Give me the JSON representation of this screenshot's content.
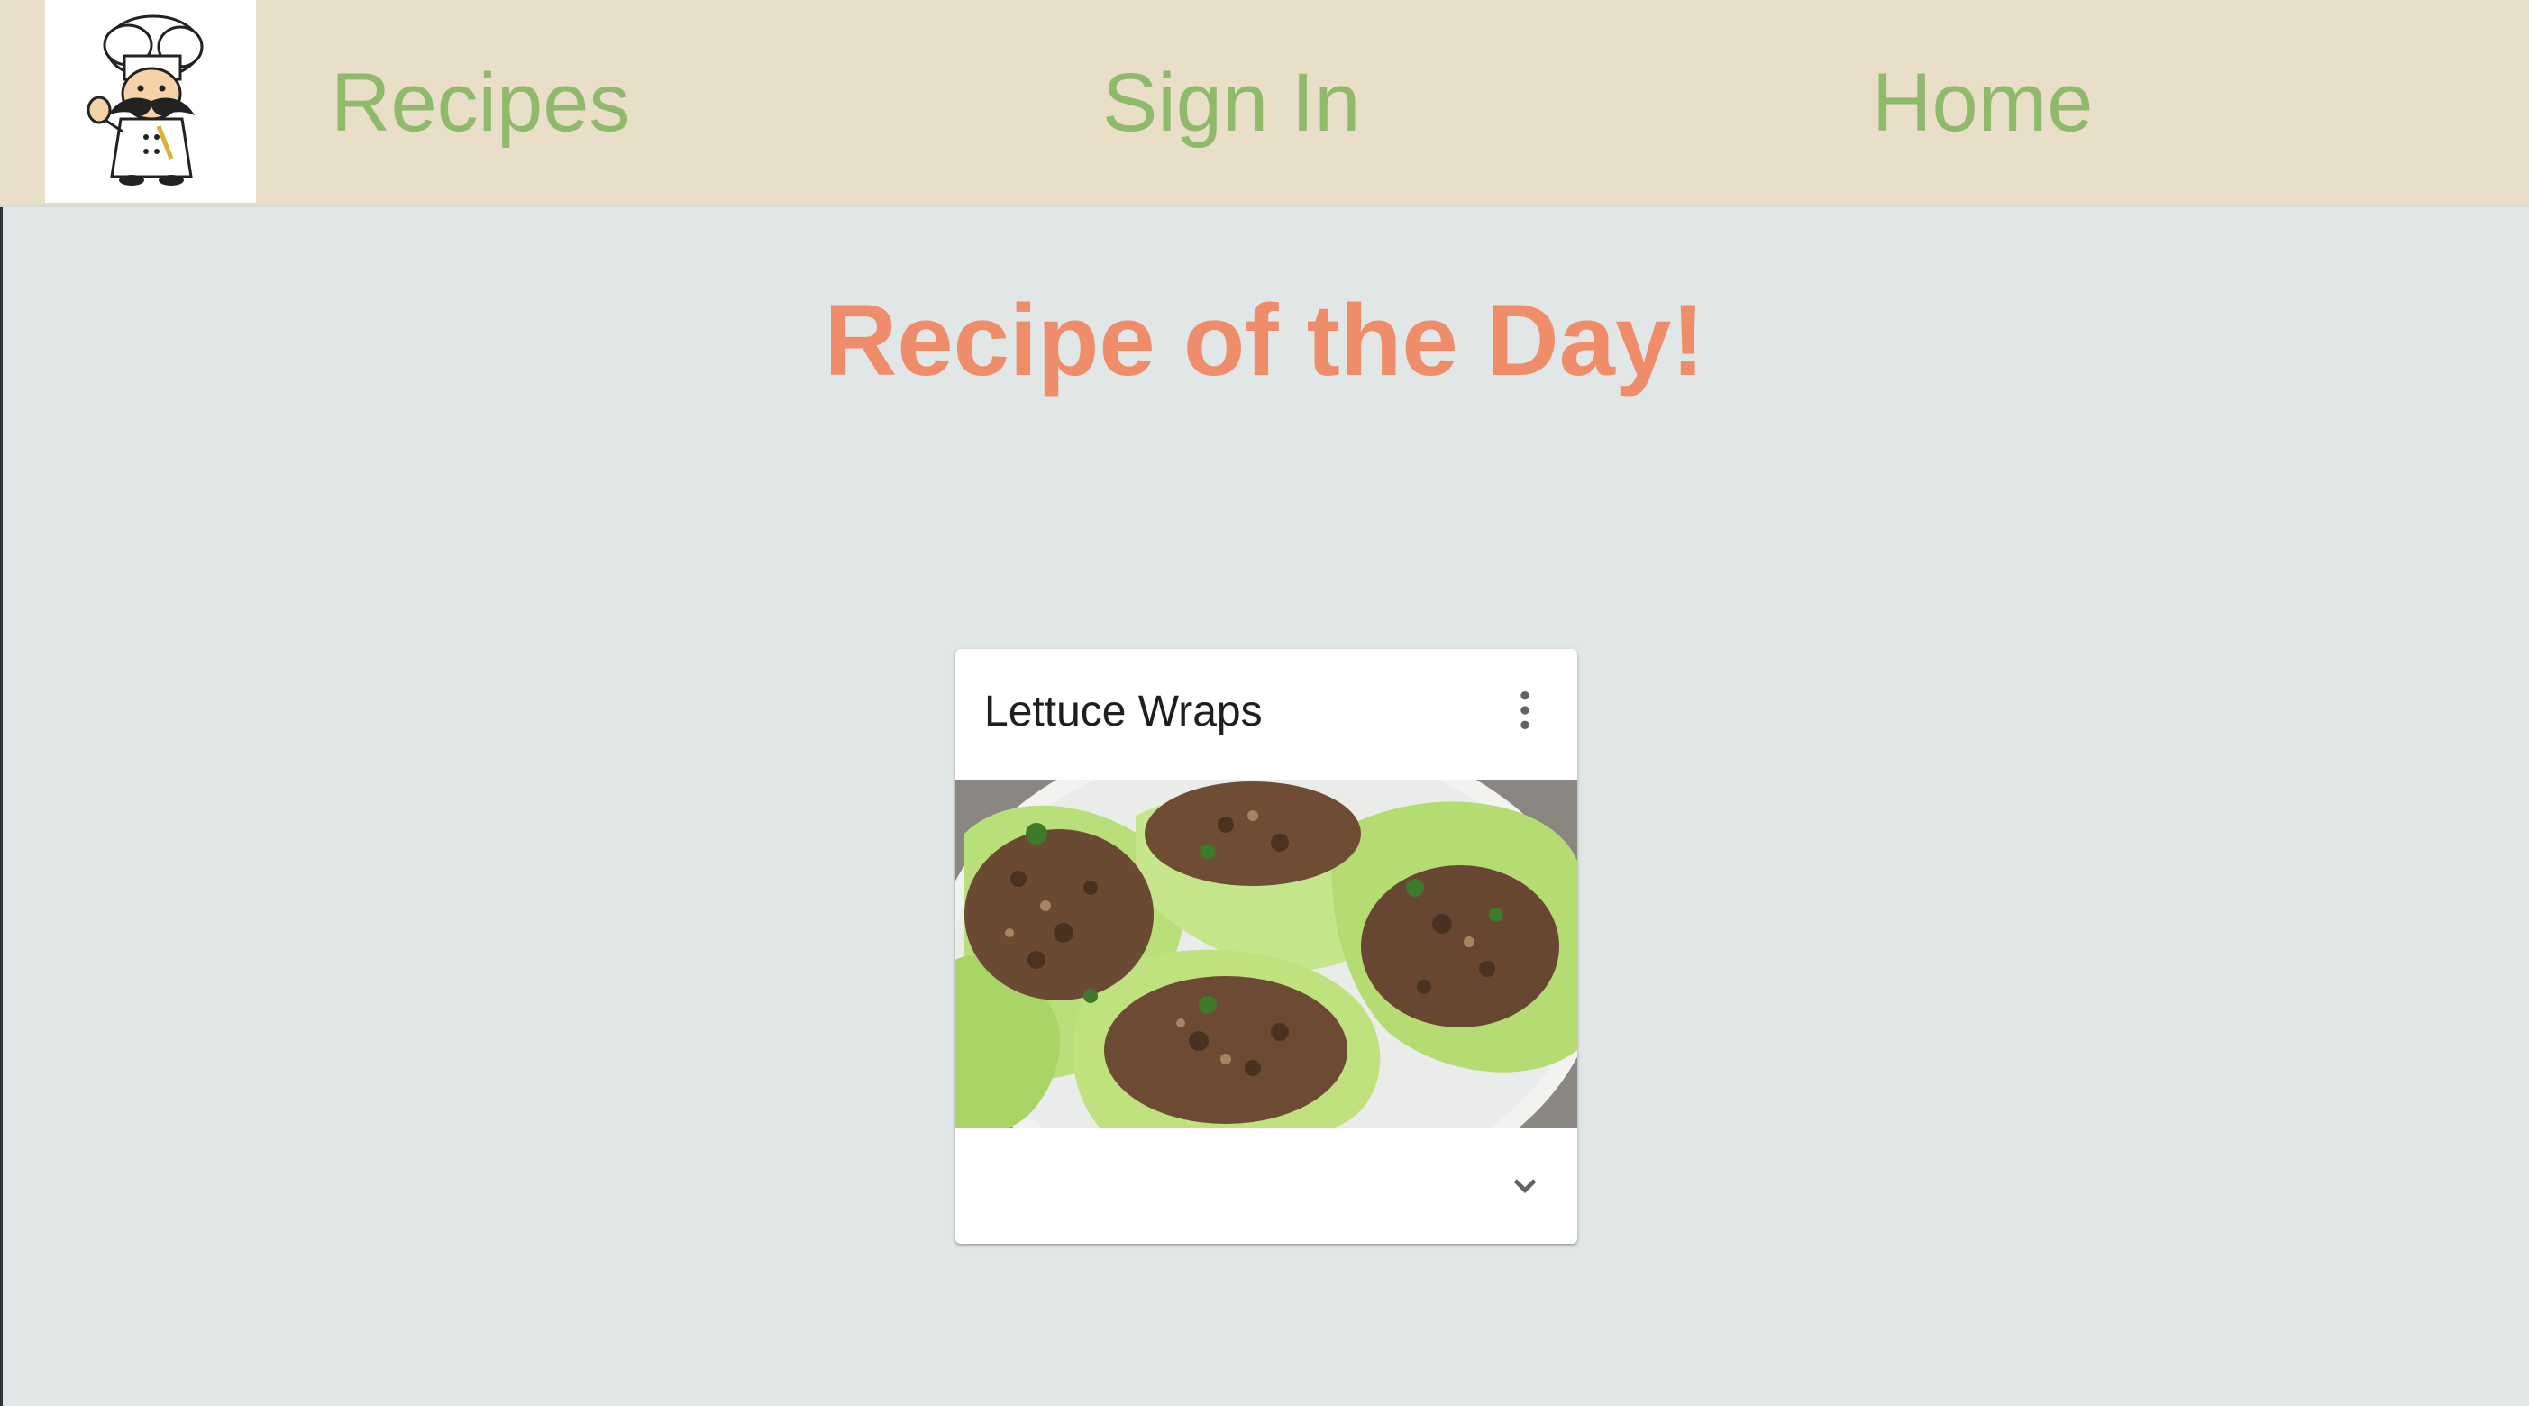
{
  "nav": {
    "logo_icon": "chef-mascot-icon",
    "links": [
      {
        "label": "Recipes"
      },
      {
        "label": "Sign In"
      },
      {
        "label": "Home"
      }
    ]
  },
  "main": {
    "title": "Recipe of the Day!"
  },
  "card": {
    "title": "Lettuce Wraps",
    "menu_icon": "more-vert-icon",
    "expand_icon": "chevron-down-icon",
    "image_subject": "lettuce-wraps-photo"
  },
  "colors": {
    "navbar_bg": "#e9dfc8",
    "nav_link": "#8fb96b",
    "page_bg": "#e1e6e6",
    "title_accent": "#ef8c69",
    "card_bg": "#ffffff"
  }
}
